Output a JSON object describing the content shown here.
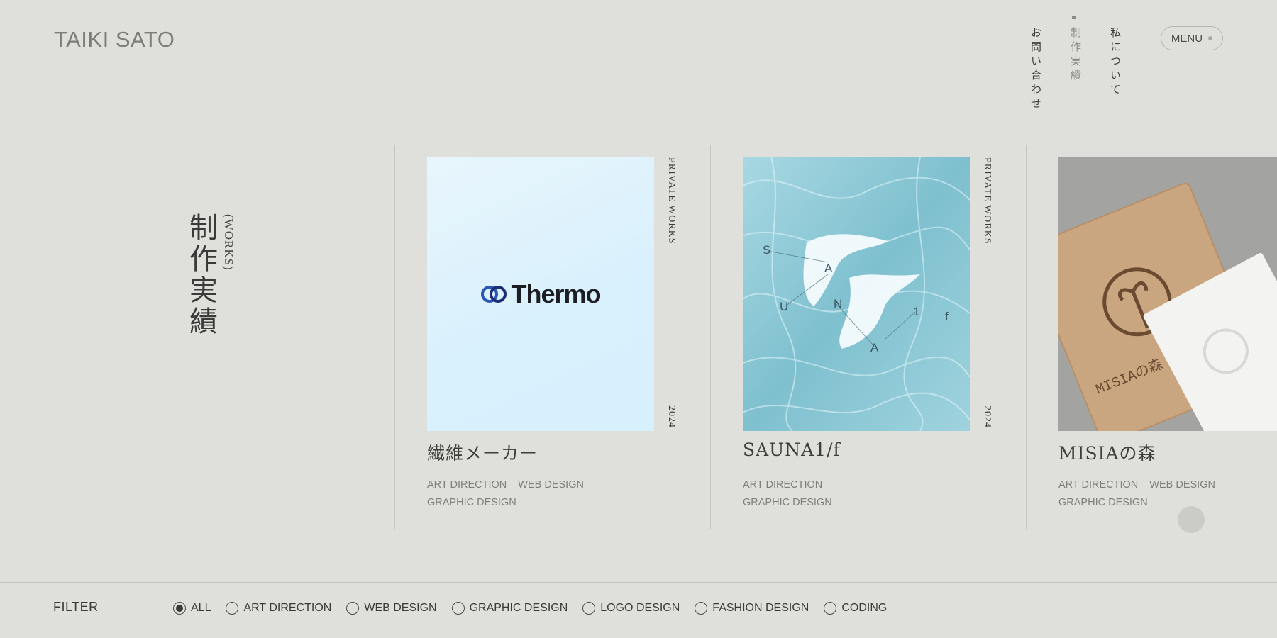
{
  "site": {
    "logo": "TAIKI SATO"
  },
  "nav": {
    "items": [
      {
        "label": "お問い合わせ"
      },
      {
        "label": "制作実績"
      },
      {
        "label": "私について"
      }
    ],
    "menu_label": "MENU"
  },
  "section": {
    "title": "制作実績",
    "subtitle": "(WORKS)"
  },
  "works": [
    {
      "category": "PRIVATE WORKS",
      "year": "2024",
      "title": "繊維メーカー",
      "image_text": "Thermo",
      "tags": [
        "ART DIRECTION",
        "WEB DESIGN",
        "GRAPHIC DESIGN"
      ]
    },
    {
      "category": "PRIVATE WORKS",
      "year": "2024",
      "title": "SAUNA1/f",
      "image_letters": [
        "S",
        "A",
        "U",
        "N",
        "A",
        "1",
        "f"
      ],
      "tags": [
        "ART DIRECTION",
        "GRAPHIC DESIGN"
      ]
    },
    {
      "title": "MISIAの森",
      "image_text": "MISIAの森",
      "tags": [
        "ART DIRECTION",
        "WEB DESIGN",
        "GRAPHIC DESIGN"
      ]
    }
  ],
  "filter": {
    "label": "FILTER",
    "options": [
      {
        "label": "ALL",
        "selected": true
      },
      {
        "label": "ART DIRECTION",
        "selected": false
      },
      {
        "label": "WEB DESIGN",
        "selected": false
      },
      {
        "label": "GRAPHIC DESIGN",
        "selected": false
      },
      {
        "label": "LOGO DESIGN",
        "selected": false
      },
      {
        "label": "FASHION DESIGN",
        "selected": false
      },
      {
        "label": "CODING",
        "selected": false
      }
    ]
  },
  "colors": {
    "background": "#dfdfdb",
    "text": "#3a3a38",
    "muted": "#7e7e7a"
  }
}
